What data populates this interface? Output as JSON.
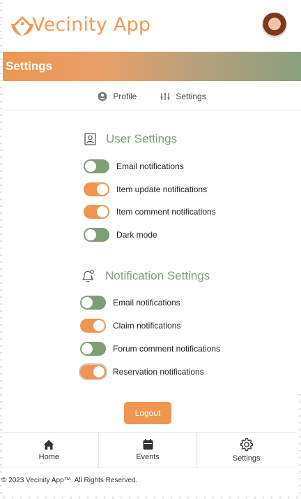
{
  "app": {
    "name": "Vecinity App"
  },
  "banner": {
    "title": "Settings"
  },
  "subnav": {
    "profile_label": "Profile",
    "settings_label": "Settings"
  },
  "user_settings": {
    "title": "User Settings",
    "items": [
      {
        "label": "Email notifications",
        "on": false
      },
      {
        "label": "Item update notifications",
        "on": true
      },
      {
        "label": "Item comment notifications",
        "on": true
      },
      {
        "label": "Dark mode",
        "on": false
      }
    ]
  },
  "notification_settings": {
    "title": "Notification Settings",
    "items": [
      {
        "label": "Email notifications",
        "on": false
      },
      {
        "label": "Claim notifications",
        "on": true
      },
      {
        "label": "Forum comment notifications",
        "on": false
      },
      {
        "label": "Reservation notifications",
        "on": true
      }
    ]
  },
  "logout_label": "Logout",
  "bottom_nav": {
    "home": "Home",
    "events": "Events",
    "settings": "Settings"
  },
  "footer": {
    "text": "© 2023 Vecinity App™. All Rights Reserved."
  },
  "colors": {
    "accent_orange": "#ef9652",
    "accent_green": "#7f9e77"
  }
}
